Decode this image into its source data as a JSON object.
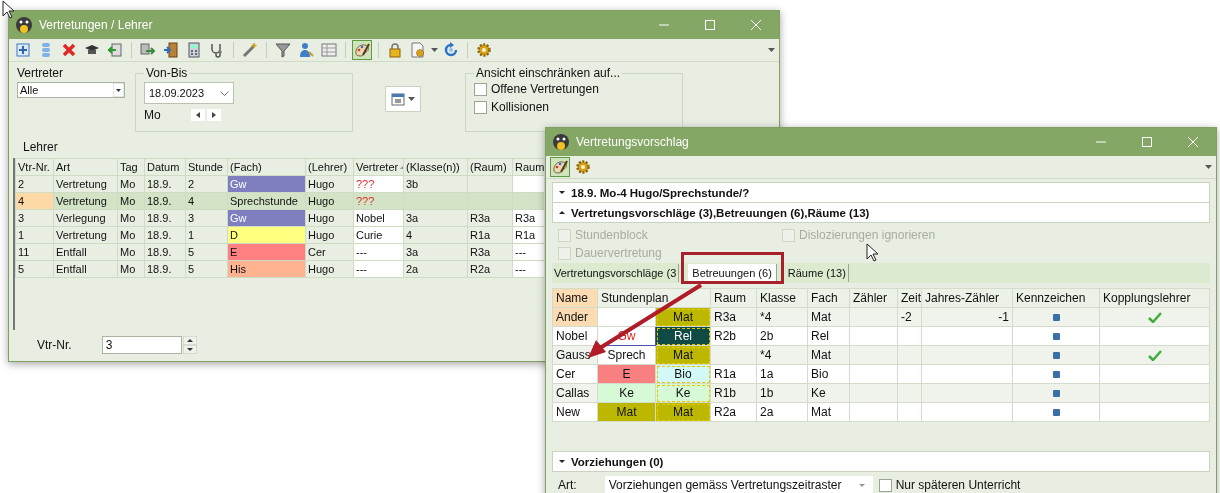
{
  "main_window": {
    "title": "Vertretungen / Lehrer",
    "filters": {
      "vertreter": {
        "label": "Vertreter",
        "value": "Alle"
      },
      "von_bis": {
        "label": "Von-Bis",
        "date": "18.09.2023",
        "day": "Mo"
      },
      "view_limit": {
        "label": "Ansicht einschränken auf...",
        "options": [
          {
            "label": "Offene Vertretungen",
            "checked": false
          },
          {
            "label": "Kollisionen",
            "checked": false
          }
        ]
      }
    },
    "section_label": "Lehrer",
    "table": {
      "columns": [
        {
          "label": "Vtr-Nr.",
          "sorted": false
        },
        {
          "label": "Art",
          "sorted": false
        },
        {
          "label": "Tag",
          "sorted": false
        },
        {
          "label": "Datum",
          "sorted": false
        },
        {
          "label": "Stunde",
          "sorted": false
        },
        {
          "label": "(Fach)",
          "sorted": false
        },
        {
          "label": "(Lehrer)",
          "sorted": false
        },
        {
          "label": "Vertreter",
          "sorted": true
        },
        {
          "label": "(Klasse(n))",
          "sorted": false
        },
        {
          "label": "(Raum)",
          "sorted": false
        },
        {
          "label": "Raum",
          "sorted": false
        }
      ],
      "rows": [
        {
          "cells": [
            "2",
            "Vertretung",
            "Mo",
            "18.9.",
            "2",
            "Gw",
            "Hugo",
            "???",
            "3b",
            null,
            null
          ],
          "selected": false,
          "color": "#7f7fbf",
          "vertreter_open": true
        },
        {
          "cells": [
            "4",
            "Vertretung",
            "Mo",
            "18.9.",
            "4",
            "Sprechstunde",
            "Hugo",
            "???",
            null,
            null,
            null
          ],
          "selected": true,
          "color": null,
          "vertreter_open": true
        },
        {
          "cells": [
            "3",
            "Verlegung",
            "Mo",
            "18.9.",
            "3",
            "Gw",
            "Hugo",
            "Nobel",
            "3a",
            "R3a",
            "R3a"
          ],
          "selected": false,
          "color": "#7f7fbf",
          "vertreter_open": false
        },
        {
          "cells": [
            "1",
            "Vertretung",
            "Mo",
            "18.9.",
            "1",
            "D",
            "Hugo",
            "Curie",
            "4",
            "R1a",
            "R1a"
          ],
          "selected": false,
          "color": "#ffff80",
          "vertreter_open": false
        },
        {
          "cells": [
            "11",
            "Entfall",
            "Mo",
            "18.9.",
            "5",
            "E",
            "Cer",
            "---",
            "3a",
            "R3a",
            "---"
          ],
          "selected": false,
          "color": "#ff8080",
          "vertreter_open": false
        },
        {
          "cells": [
            "5",
            "Entfall",
            "Mo",
            "18.9.",
            "5",
            "His",
            "Hugo",
            "---",
            "2a",
            "R2a",
            "---"
          ],
          "selected": false,
          "color": "#ffb391",
          "vertreter_open": false
        }
      ]
    },
    "vtr_field": {
      "label": "Vtr-Nr.",
      "value": "3"
    }
  },
  "proposal_window": {
    "title": "Vertretungsvorschlag",
    "sections": [
      {
        "title": "18.9. Mo-4 Hugo/Sprechstunde/?",
        "expanded": false
      },
      {
        "title": "Vertretungsvorschläge (3),Betreuungen (6),Räume (13)",
        "expanded": true
      }
    ],
    "options": [
      {
        "label": "Stundenblock",
        "checked": false,
        "disabled": true
      },
      {
        "label": "Dislozierungen ignorieren",
        "checked": false,
        "disabled": true
      },
      {
        "label": "Dauervertretung",
        "checked": false,
        "disabled": true
      }
    ],
    "tabs": [
      {
        "label": "Vertretungsvorschläge (3",
        "selected": false
      },
      {
        "label": "Betreuungen (6)",
        "selected": true
      },
      {
        "label": "Räume (13)",
        "selected": false
      }
    ],
    "table": {
      "columns": [
        "Name",
        "Stundenplan",
        "Raum",
        "Klasse",
        "Fach",
        "Zähler",
        "Zeit",
        "Jahres-Zähler",
        "Kennzeichen",
        "Kopplungslehrer"
      ],
      "rows": [
        {
          "name": "Ander",
          "selected": true,
          "plan": [
            {
              "color": "#ffffff",
              "marked": false
            },
            {
              "text": "Mat",
              "color": "#bcb800",
              "marked": false
            }
          ],
          "raum": "R3a",
          "klasse": "*4",
          "fach": "Mat",
          "zeit": "-2",
          "jahres_zaehler": "-1",
          "coupled": true
        },
        {
          "name": "Nobel",
          "selected": false,
          "plan": [
            {
              "text": "Gw",
              "color": "#ffffff",
              "marked": true
            },
            {
              "text": "Rel",
              "color": "#0f4a45",
              "marked": false
            }
          ],
          "raum": "R2b",
          "klasse": "2b",
          "fach": "Rel",
          "zeit": null,
          "jahres_zaehler": null,
          "coupled": false
        },
        {
          "name": "Gauss",
          "selected": false,
          "plan": [
            {
              "text": "Sprech",
              "color": "#ffffff",
              "marked": false
            },
            {
              "text": "Mat",
              "color": "#bcb800",
              "marked": false
            }
          ],
          "raum": null,
          "klasse": "*4",
          "fach": "Mat",
          "zeit": null,
          "jahres_zaehler": null,
          "coupled": true
        },
        {
          "name": "Cer",
          "selected": false,
          "plan": [
            {
              "text": "E",
              "color": "#f98080",
              "marked": false
            },
            {
              "text": "Bio",
              "color": "#d2f8f8",
              "marked": false
            }
          ],
          "raum": "R1a",
          "klasse": "1a",
          "fach": "Bio",
          "zeit": null,
          "jahres_zaehler": null,
          "coupled": false
        },
        {
          "name": "Callas",
          "selected": false,
          "plan": [
            {
              "text": "Ke",
              "color": "#d6fad6",
              "marked": false
            },
            {
              "text": "Ke",
              "color": "#d6fad6",
              "marked": false
            }
          ],
          "raum": "R1b",
          "klasse": "1b",
          "fach": "Ke",
          "zeit": null,
          "jahres_zaehler": null,
          "coupled": false
        },
        {
          "name": "New",
          "selected": false,
          "plan": [
            {
              "text": "Mat",
              "color": "#bcb800",
              "marked": false
            },
            {
              "text": "Mat",
              "color": "#bcb800",
              "marked": false
            }
          ],
          "raum": "R2a",
          "klasse": "2a",
          "fach": "Mat",
          "zeit": null,
          "jahres_zaehler": null,
          "coupled": false
        }
      ]
    },
    "vorziehungen": {
      "title": "Vorziehungen (0)",
      "expanded": false
    },
    "art": {
      "label": "Art:",
      "value": "Vorziehungen gemäss Vertretungszeitraster",
      "option": {
        "label": "Nur späteren Unterricht",
        "checked": false
      }
    }
  }
}
